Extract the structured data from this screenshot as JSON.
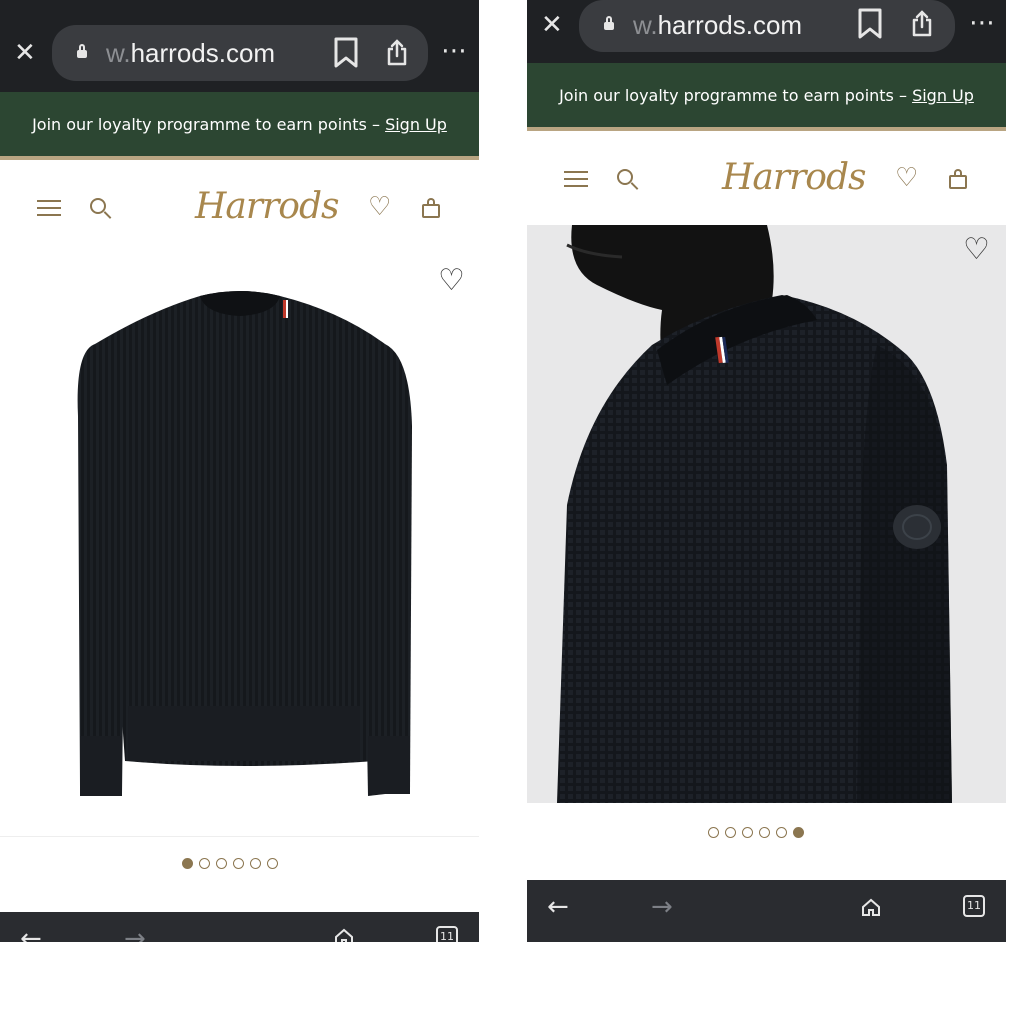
{
  "browser": {
    "url_prefix": "w.",
    "url_domain": "harrods.com",
    "close_icon": "close-icon",
    "more_icon": "more-dots-icon"
  },
  "banner": {
    "text": "Join our loyalty programme to earn points – ",
    "link": "Sign Up",
    "bg_color": "#2c4632"
  },
  "header": {
    "logo": "Harrods",
    "brand_color": "#a8874d"
  },
  "left_screen": {
    "image": "black ribbed-knit crew neck sweater, product shot",
    "carousel_total": 6,
    "carousel_active": 1
  },
  "right_screen": {
    "image": "model wearing black ribbed-knit sweater with shoulder logo patch",
    "carousel_total": 6,
    "carousel_active": 6,
    "tab_count": "11"
  },
  "left_bottom": {
    "tab_count": "11"
  }
}
